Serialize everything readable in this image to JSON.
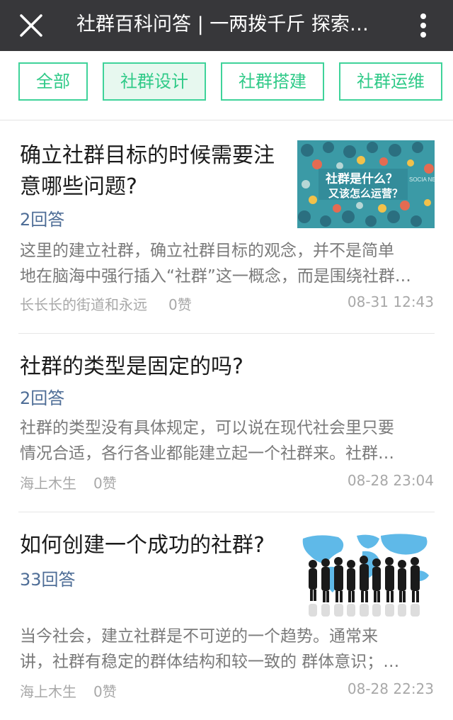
{
  "header": {
    "title": "社群百科问答 | 一两拨千斤 探索社群运营之道"
  },
  "tabs": [
    {
      "label": "全部",
      "active": false
    },
    {
      "label": "社群设计",
      "active": true
    },
    {
      "label": "社群搭建",
      "active": false
    },
    {
      "label": "社群运维",
      "active": false
    }
  ],
  "posts": [
    {
      "title_lines": [
        "确立社群目标的时候需要注",
        "意哪些问题?"
      ],
      "answers": "2回答",
      "excerpt_lines": [
        "这里的建立社群，确立社群目标的观念，并不是简单",
        "地在脑海中强行插入“社群”这一概念，而是围绕社群…"
      ],
      "author": "长长长的街道和永远",
      "likes": "0赞",
      "time": "08-31 12:43",
      "thumbnail": {
        "type": "social-network-icons",
        "caption_line1": "社群是什么？",
        "caption_line2": "又该怎么运营？",
        "side_text": "SOCIA NETWO"
      }
    },
    {
      "title_lines": [
        "社群的类型是固定的吗?"
      ],
      "answers": "2回答",
      "excerpt_lines": [
        "社群的类型没有具体规定，可以说在现代社会里只要",
        "情况合适，各行各业都能建立起一个社群来。社群…"
      ],
      "author": "海上木生",
      "likes": "0赞",
      "time": "08-28 23:04"
    },
    {
      "title_lines": [
        "如何创建一个成功的社群?"
      ],
      "answers": "33回答",
      "excerpt_lines": [
        "当今社会，建立社群是不可逆的一个趋势。通常来",
        "讲，社群有稳定的群体结构和较一致的 群体意识；…"
      ],
      "author": "海上木生",
      "likes": "0赞",
      "time": "08-28 22:23",
      "thumbnail": {
        "type": "business-people-world-map"
      }
    }
  ],
  "colors": {
    "titlebar": "#37373a",
    "accent_green": "#3fd39a",
    "active_tab_bg": "#e7f8ef",
    "answer_link": "#4f6e97"
  }
}
